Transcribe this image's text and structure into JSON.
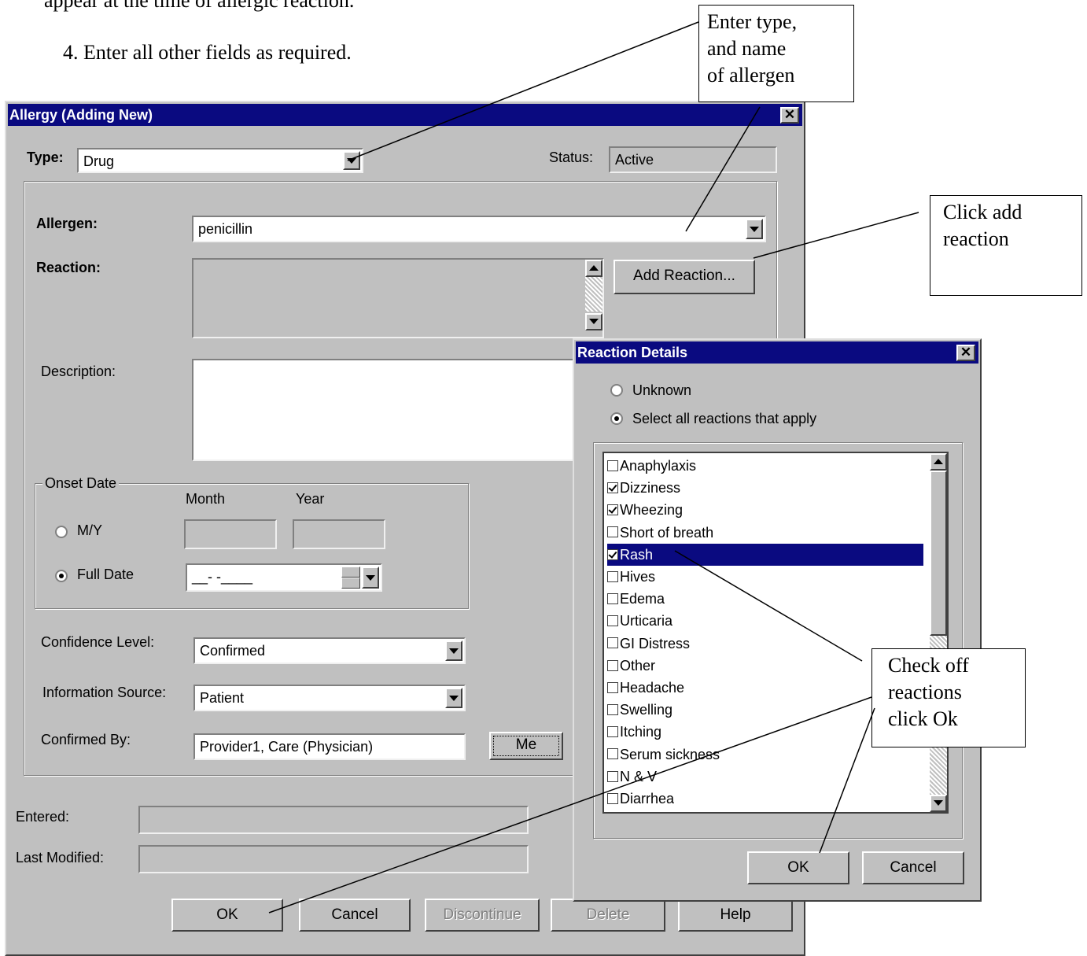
{
  "doc": {
    "line_top": "appear at the time of allergic reaction.",
    "step4": "4.  Enter all other fields as required."
  },
  "allergy": {
    "title": "Allergy (Adding New)",
    "type_label": "Type:",
    "type_value": "Drug",
    "status_label": "Status:",
    "status_value": "Active",
    "allergen_label": "Allergen:",
    "allergen_value": "penicillin",
    "reaction_label": "Reaction:",
    "add_reaction_label": "Add Reaction...",
    "description_label": "Description:",
    "onset_legend": "Onset Date",
    "month_label": "Month",
    "year_label": "Year",
    "my_label": "M/Y",
    "full_date_label": "Full Date",
    "full_date_value": "__-    -____",
    "confidence_label": "Confidence Level:",
    "confidence_value": "Confirmed",
    "info_source_label": "Information Source:",
    "info_source_value": "Patient",
    "confirmed_by_label": "Confirmed By:",
    "confirmed_by_value": "Provider1, Care (Physician)",
    "me_label": "Me",
    "entered_label": "Entered:",
    "last_modified_label": "Last Modified:",
    "buttons": {
      "ok": "OK",
      "cancel": "Cancel",
      "discontinue": "Discontinue",
      "delete": "Delete",
      "help": "Help"
    }
  },
  "reaction_details": {
    "title": "Reaction Details",
    "unknown_label": "Unknown",
    "select_all_label": "Select all reactions that apply",
    "items": [
      {
        "label": "Anaphylaxis",
        "checked": false
      },
      {
        "label": "Dizziness",
        "checked": true
      },
      {
        "label": "Wheezing",
        "checked": true
      },
      {
        "label": "Short of breath",
        "checked": false
      },
      {
        "label": "Rash",
        "checked": true
      },
      {
        "label": "Hives",
        "checked": false
      },
      {
        "label": "Edema",
        "checked": false
      },
      {
        "label": "Urticaria",
        "checked": false
      },
      {
        "label": "GI Distress",
        "checked": false
      },
      {
        "label": "Other",
        "checked": false
      },
      {
        "label": "Headache",
        "checked": false
      },
      {
        "label": "Swelling",
        "checked": false
      },
      {
        "label": "Itching",
        "checked": false
      },
      {
        "label": "Serum sickness",
        "checked": false
      },
      {
        "label": "N & V",
        "checked": false
      },
      {
        "label": "Diarrhea",
        "checked": false
      }
    ],
    "ok": "OK",
    "cancel": "Cancel"
  },
  "callouts": {
    "type_allergen": [
      "Enter type,",
      "and name",
      "of allergen"
    ],
    "add_reaction": [
      "Click add",
      "reaction"
    ],
    "check_off": [
      "Check off",
      "reactions",
      "click Ok"
    ]
  }
}
